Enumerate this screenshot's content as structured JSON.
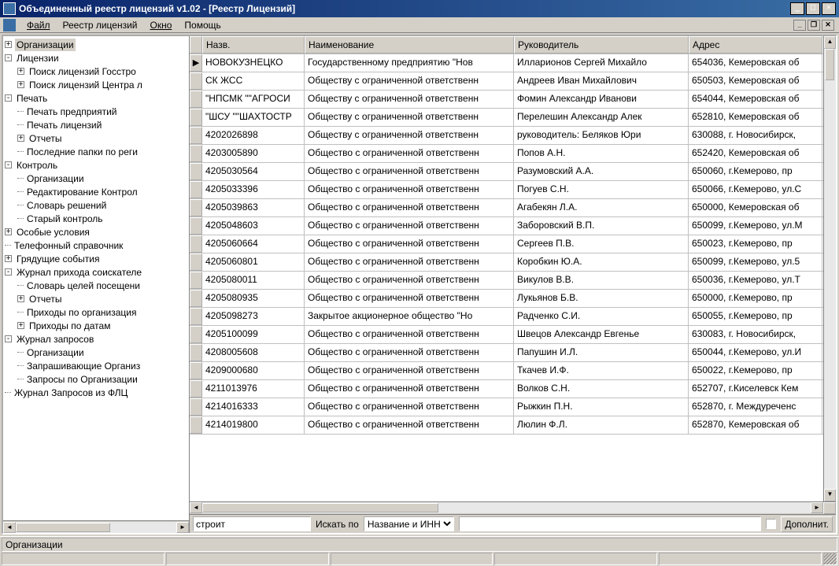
{
  "titlebar": {
    "text": "Объединенный реестр лицензий v1.02 - [Реестр Лицензий]"
  },
  "menu": {
    "file": "Файл",
    "registry": "Реестр лицензий",
    "window": "Окно",
    "help": "Помощь"
  },
  "tree": [
    {
      "level": 0,
      "collapser": "+",
      "label": "Организации",
      "selected": true
    },
    {
      "level": 0,
      "collapser": "-",
      "label": "Лицензии"
    },
    {
      "level": 1,
      "collapser": "+",
      "label": "Поиск лицензий Госстро"
    },
    {
      "level": 1,
      "collapser": "+",
      "label": "Поиск лицензий Центра л"
    },
    {
      "level": 0,
      "collapser": "-",
      "label": "Печать"
    },
    {
      "level": 1,
      "collapser": "",
      "label": "Печать предприятий"
    },
    {
      "level": 1,
      "collapser": "",
      "label": "Печать лицензий"
    },
    {
      "level": 1,
      "collapser": "+",
      "label": "Отчеты"
    },
    {
      "level": 1,
      "collapser": "",
      "label": "Последние папки по реги"
    },
    {
      "level": 0,
      "collapser": "-",
      "label": "Контроль"
    },
    {
      "level": 1,
      "collapser": "",
      "label": "Организации"
    },
    {
      "level": 1,
      "collapser": "",
      "label": "Редактирование Контрол"
    },
    {
      "level": 1,
      "collapser": "",
      "label": "Словарь решений"
    },
    {
      "level": 1,
      "collapser": "",
      "label": "Старый контроль"
    },
    {
      "level": 0,
      "collapser": "+",
      "label": "Особые условия"
    },
    {
      "level": 0,
      "collapser": "",
      "label": "Телефонный справочник"
    },
    {
      "level": 0,
      "collapser": "+",
      "label": "Грядущие события"
    },
    {
      "level": 0,
      "collapser": "-",
      "label": "Журнал прихода соискателе"
    },
    {
      "level": 1,
      "collapser": "",
      "label": "Словарь целей посещени"
    },
    {
      "level": 1,
      "collapser": "+",
      "label": "Отчеты"
    },
    {
      "level": 1,
      "collapser": "",
      "label": "Приходы по организация"
    },
    {
      "level": 1,
      "collapser": "+",
      "label": "Приходы по датам"
    },
    {
      "level": 0,
      "collapser": "-",
      "label": "Журнал запросов"
    },
    {
      "level": 1,
      "collapser": "",
      "label": "Организации"
    },
    {
      "level": 1,
      "collapser": "",
      "label": "Запрашивающие Организ"
    },
    {
      "level": 1,
      "collapser": "",
      "label": "Запросы по Организации"
    },
    {
      "level": 0,
      "collapser": "",
      "label": "Журнал Запросов из ФЛЦ"
    }
  ],
  "grid": {
    "columns": [
      "Назв.",
      "Наименование",
      "Руководитель",
      "Адрес"
    ],
    "rows": [
      {
        "ind": "▶",
        "c": [
          " НОВОКУЗНЕЦКО",
          "Государственному предприятию \"Нов",
          "Илларионов Сергей Михайло",
          "654036, Кемеровская об"
        ]
      },
      {
        "ind": "",
        "c": [
          " СК ЖСС",
          "Обществу с ограниченной ответственн",
          "Андреев Иван Михайлович",
          "650503, Кемеровская об"
        ]
      },
      {
        "ind": "",
        "c": [
          "\"НПСМК \"\"АГРОСИ",
          "Обществу с ограниченной ответственн",
          "Фомин Александр Иванови",
          "654044, Кемеровская об"
        ]
      },
      {
        "ind": "",
        "c": [
          "\"ШСУ \"\"ШАХТОСТР",
          "Обществу с ограниченной ответственн",
          "Перелешин Александр Алек",
          "652810, Кемеровская об"
        ]
      },
      {
        "ind": "",
        "c": [
          "4202026898",
          "Обществу с ограниченной ответственн",
          "руководитель: Беляков Юри",
          "630088, г. Новосибирск,"
        ]
      },
      {
        "ind": "",
        "c": [
          "4203005890",
          "Общество с ограниченной ответственн",
          "Попов А.Н.",
          "652420, Кемеровская об"
        ]
      },
      {
        "ind": "",
        "c": [
          "4205030564",
          "Общество с ограниченной ответственн",
          "Разумовский А.А.",
          " 650060, г.Кемерово, пр"
        ]
      },
      {
        "ind": "",
        "c": [
          "4205033396",
          "Общество с ограниченной ответственн",
          "Погуев С.Н.",
          " 650066, г.Кемерово, ул.С"
        ]
      },
      {
        "ind": "",
        "c": [
          "4205039863",
          "Общество с ограниченной ответственн",
          "Агабекян Л.А.",
          " 650000, Кемеровская об"
        ]
      },
      {
        "ind": "",
        "c": [
          "4205048603",
          "Общество с ограниченной ответственн",
          "Заборовский В.П.",
          " 650099, г.Кемерово, ул.М"
        ]
      },
      {
        "ind": "",
        "c": [
          "4205060664",
          "Общество с ограниченной ответственн",
          "Сергеев П.В.",
          " 650023, г.Кемерово, пр"
        ]
      },
      {
        "ind": "",
        "c": [
          "4205060801",
          "Общество с ограниченной ответственн",
          "Коробкин Ю.А.",
          " 650099, г.Кемерово, ул.5"
        ]
      },
      {
        "ind": "",
        "c": [
          "4205080011",
          "Общество с ограниченной ответственн",
          "Викулов В.В.",
          " 650036, г.Кемерово, ул.Т"
        ]
      },
      {
        "ind": "",
        "c": [
          "4205080935",
          "Общество с ограниченной ответственн",
          "Лукьянов Б.В.",
          " 650000, г.Кемерово, пр"
        ]
      },
      {
        "ind": "",
        "c": [
          "4205098273",
          "Закрытое акционерное общество \"Но",
          "Радченко С.И.",
          " 650055, г.Кемерово, пр"
        ]
      },
      {
        "ind": "",
        "c": [
          "4205100099",
          "Общество с ограниченной ответственн",
          "Швецов Александр Евгенье",
          "630083, г. Новосибирск,"
        ]
      },
      {
        "ind": "",
        "c": [
          "4208005608",
          "Общество с ограниченной ответственн",
          "Папушин И.Л.",
          " 650044, г.Кемерово, ул.И"
        ]
      },
      {
        "ind": "",
        "c": [
          "4209000680",
          "Общество с ограниченной ответственн",
          "Ткачев И.Ф.",
          " 650022, г.Кемерово, пр"
        ]
      },
      {
        "ind": "",
        "c": [
          "4211013976",
          "Общество с ограниченной ответственн",
          "Волков С.Н.",
          " 652707, г.Киселевск Кем"
        ]
      },
      {
        "ind": "",
        "c": [
          "4214016333",
          "Общество с ограниченной ответственн",
          "Рыжкин П.Н.",
          " 652870, г. Междуреченс"
        ]
      },
      {
        "ind": "",
        "c": [
          "4214019800",
          "Общество с ограниченной ответственн",
          "Люлин Ф.Л.",
          " 652870, Кемеровская об"
        ]
      }
    ]
  },
  "search": {
    "input_value": "строит",
    "label": "Искать по",
    "combo_value": "Название и ИНН",
    "extra_btn": "Дополнит."
  },
  "status": {
    "text": "Организации"
  }
}
